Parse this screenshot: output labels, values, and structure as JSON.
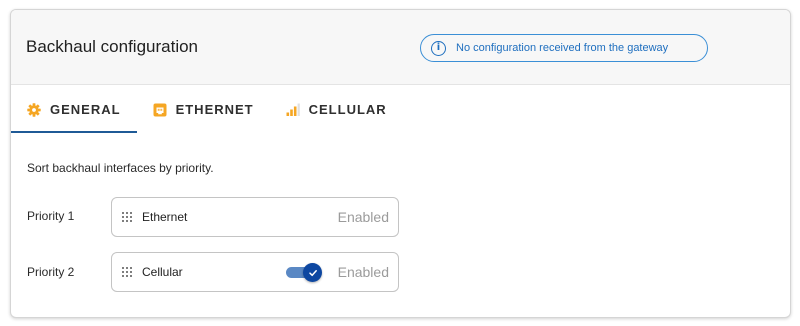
{
  "header": {
    "title": "Backhaul configuration",
    "info_message": "No configuration received from the gateway",
    "info_icon": "info-icon"
  },
  "tabs": [
    {
      "label": "GENERAL",
      "icon": "gear-icon",
      "active": true
    },
    {
      "label": "ETHERNET",
      "icon": "ethernet-port-icon",
      "active": false
    },
    {
      "label": "CELLULAR",
      "icon": "signal-bars-icon",
      "active": false
    }
  ],
  "hint": "Sort backhaul interfaces by priority.",
  "priorities": [
    {
      "label": "Priority 1",
      "name": "Ethernet",
      "status": "Enabled",
      "has_toggle": false
    },
    {
      "label": "Priority 2",
      "name": "Cellular",
      "status": "Enabled",
      "has_toggle": true,
      "toggle_on": true
    }
  ],
  "colors": {
    "accent": "#0d47a1",
    "info": "#1f6fbf",
    "tab_icon": "#f5a623",
    "status_text": "#9b9b9b"
  }
}
